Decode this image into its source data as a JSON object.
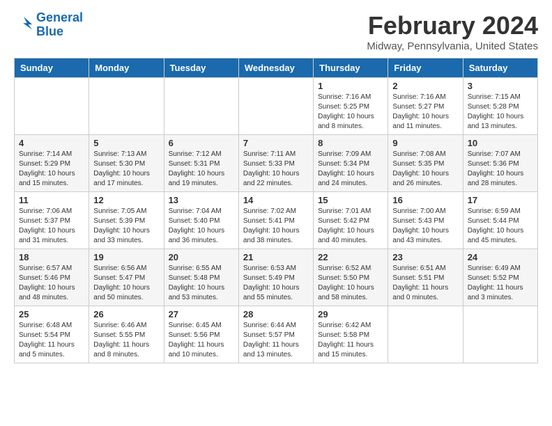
{
  "logo": {
    "line1": "General",
    "line2": "Blue"
  },
  "title": "February 2024",
  "location": "Midway, Pennsylvania, United States",
  "days_of_week": [
    "Sunday",
    "Monday",
    "Tuesday",
    "Wednesday",
    "Thursday",
    "Friday",
    "Saturday"
  ],
  "weeks": [
    [
      {
        "day": "",
        "info": ""
      },
      {
        "day": "",
        "info": ""
      },
      {
        "day": "",
        "info": ""
      },
      {
        "day": "",
        "info": ""
      },
      {
        "day": "1",
        "info": "Sunrise: 7:16 AM\nSunset: 5:25 PM\nDaylight: 10 hours\nand 8 minutes."
      },
      {
        "day": "2",
        "info": "Sunrise: 7:16 AM\nSunset: 5:27 PM\nDaylight: 10 hours\nand 11 minutes."
      },
      {
        "day": "3",
        "info": "Sunrise: 7:15 AM\nSunset: 5:28 PM\nDaylight: 10 hours\nand 13 minutes."
      }
    ],
    [
      {
        "day": "4",
        "info": "Sunrise: 7:14 AM\nSunset: 5:29 PM\nDaylight: 10 hours\nand 15 minutes."
      },
      {
        "day": "5",
        "info": "Sunrise: 7:13 AM\nSunset: 5:30 PM\nDaylight: 10 hours\nand 17 minutes."
      },
      {
        "day": "6",
        "info": "Sunrise: 7:12 AM\nSunset: 5:31 PM\nDaylight: 10 hours\nand 19 minutes."
      },
      {
        "day": "7",
        "info": "Sunrise: 7:11 AM\nSunset: 5:33 PM\nDaylight: 10 hours\nand 22 minutes."
      },
      {
        "day": "8",
        "info": "Sunrise: 7:09 AM\nSunset: 5:34 PM\nDaylight: 10 hours\nand 24 minutes."
      },
      {
        "day": "9",
        "info": "Sunrise: 7:08 AM\nSunset: 5:35 PM\nDaylight: 10 hours\nand 26 minutes."
      },
      {
        "day": "10",
        "info": "Sunrise: 7:07 AM\nSunset: 5:36 PM\nDaylight: 10 hours\nand 28 minutes."
      }
    ],
    [
      {
        "day": "11",
        "info": "Sunrise: 7:06 AM\nSunset: 5:37 PM\nDaylight: 10 hours\nand 31 minutes."
      },
      {
        "day": "12",
        "info": "Sunrise: 7:05 AM\nSunset: 5:39 PM\nDaylight: 10 hours\nand 33 minutes."
      },
      {
        "day": "13",
        "info": "Sunrise: 7:04 AM\nSunset: 5:40 PM\nDaylight: 10 hours\nand 36 minutes."
      },
      {
        "day": "14",
        "info": "Sunrise: 7:02 AM\nSunset: 5:41 PM\nDaylight: 10 hours\nand 38 minutes."
      },
      {
        "day": "15",
        "info": "Sunrise: 7:01 AM\nSunset: 5:42 PM\nDaylight: 10 hours\nand 40 minutes."
      },
      {
        "day": "16",
        "info": "Sunrise: 7:00 AM\nSunset: 5:43 PM\nDaylight: 10 hours\nand 43 minutes."
      },
      {
        "day": "17",
        "info": "Sunrise: 6:59 AM\nSunset: 5:44 PM\nDaylight: 10 hours\nand 45 minutes."
      }
    ],
    [
      {
        "day": "18",
        "info": "Sunrise: 6:57 AM\nSunset: 5:46 PM\nDaylight: 10 hours\nand 48 minutes."
      },
      {
        "day": "19",
        "info": "Sunrise: 6:56 AM\nSunset: 5:47 PM\nDaylight: 10 hours\nand 50 minutes."
      },
      {
        "day": "20",
        "info": "Sunrise: 6:55 AM\nSunset: 5:48 PM\nDaylight: 10 hours\nand 53 minutes."
      },
      {
        "day": "21",
        "info": "Sunrise: 6:53 AM\nSunset: 5:49 PM\nDaylight: 10 hours\nand 55 minutes."
      },
      {
        "day": "22",
        "info": "Sunrise: 6:52 AM\nSunset: 5:50 PM\nDaylight: 10 hours\nand 58 minutes."
      },
      {
        "day": "23",
        "info": "Sunrise: 6:51 AM\nSunset: 5:51 PM\nDaylight: 11 hours\nand 0 minutes."
      },
      {
        "day": "24",
        "info": "Sunrise: 6:49 AM\nSunset: 5:52 PM\nDaylight: 11 hours\nand 3 minutes."
      }
    ],
    [
      {
        "day": "25",
        "info": "Sunrise: 6:48 AM\nSunset: 5:54 PM\nDaylight: 11 hours\nand 5 minutes."
      },
      {
        "day": "26",
        "info": "Sunrise: 6:46 AM\nSunset: 5:55 PM\nDaylight: 11 hours\nand 8 minutes."
      },
      {
        "day": "27",
        "info": "Sunrise: 6:45 AM\nSunset: 5:56 PM\nDaylight: 11 hours\nand 10 minutes."
      },
      {
        "day": "28",
        "info": "Sunrise: 6:44 AM\nSunset: 5:57 PM\nDaylight: 11 hours\nand 13 minutes."
      },
      {
        "day": "29",
        "info": "Sunrise: 6:42 AM\nSunset: 5:58 PM\nDaylight: 11 hours\nand 15 minutes."
      },
      {
        "day": "",
        "info": ""
      },
      {
        "day": "",
        "info": ""
      }
    ]
  ]
}
